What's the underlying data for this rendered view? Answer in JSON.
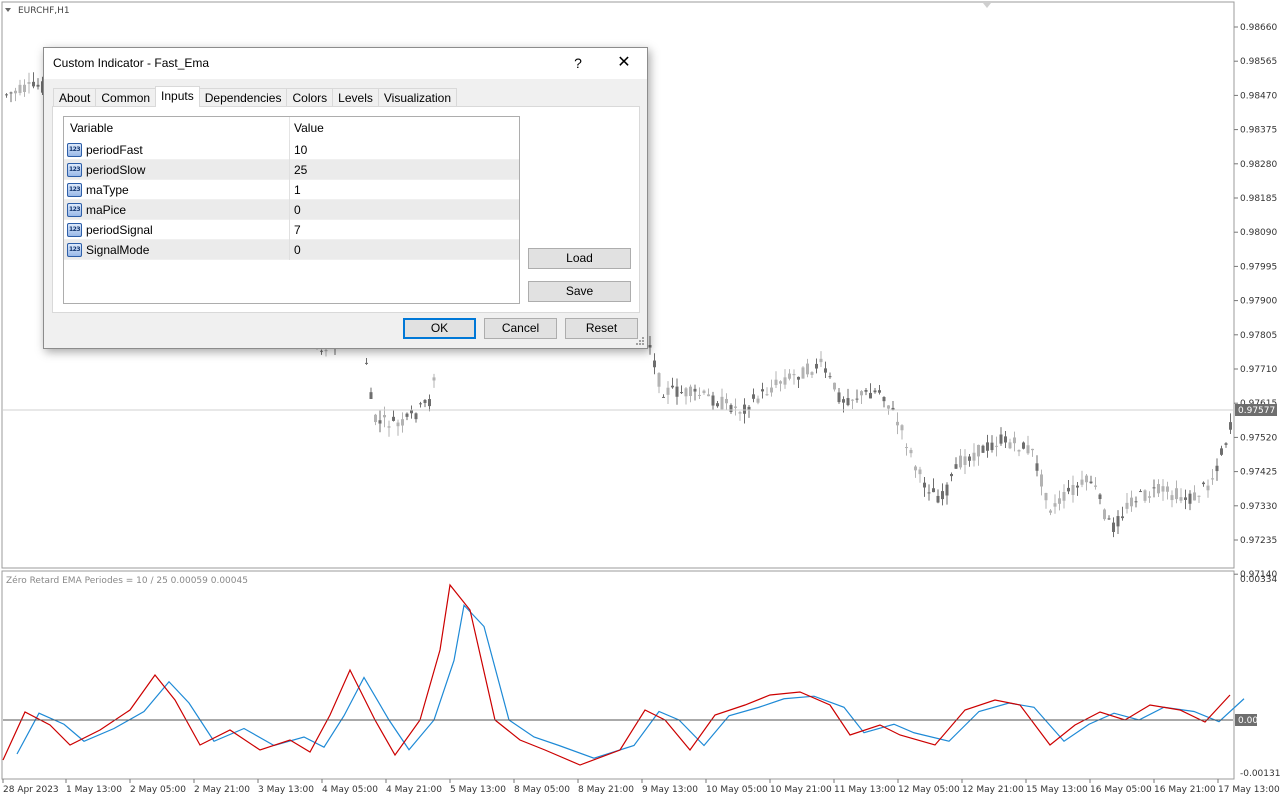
{
  "chart": {
    "symbol_label": "EURCHF,H1",
    "indicator_label": "Zéro Retard EMA Periodes = 10 / 25  0.00059 0.00045",
    "price_labels": [
      "0.98660",
      "0.98565",
      "0.98470",
      "0.98375",
      "0.98280",
      "0.98185",
      "0.98090",
      "0.97995",
      "0.97900",
      "0.97805",
      "0.97710",
      "0.97615",
      "0.97520",
      "0.97425",
      "0.97330",
      "0.97235",
      "0.97140"
    ],
    "current_price": "0.97577",
    "indicator_labels": [
      "0.00334",
      "0.00",
      "-0.00131"
    ],
    "time_labels": [
      "28 Apr 2023",
      "1 May 13:00",
      "2 May 05:00",
      "2 May 21:00",
      "3 May 13:00",
      "4 May 05:00",
      "4 May 21:00",
      "5 May 13:00",
      "8 May 05:00",
      "8 May 21:00",
      "9 May 13:00",
      "10 May 05:00",
      "10 May 21:00",
      "11 May 13:00",
      "12 May 05:00",
      "12 May 21:00",
      "15 May 13:00",
      "16 May 05:00",
      "16 May 21:00",
      "17 May 13:00"
    ],
    "colors": {
      "bull": "#b3b3b3",
      "bear": "#6e6e6e",
      "fast_line": "#cc0000",
      "slow_line": "#1e8ad6",
      "price_tag_bg": "#6e6e6e"
    }
  },
  "dialog": {
    "title": "Custom Indicator - Fast_Ema",
    "help_glyph": "?",
    "close_glyph": "✕",
    "tabs": [
      {
        "label": "About",
        "active": false
      },
      {
        "label": "Common",
        "active": false
      },
      {
        "label": "Inputs",
        "active": true
      },
      {
        "label": "Dependencies",
        "active": false
      },
      {
        "label": "Colors",
        "active": false
      },
      {
        "label": "Levels",
        "active": false
      },
      {
        "label": "Visualization",
        "active": false
      }
    ],
    "columns": {
      "variable": "Variable",
      "value": "Value"
    },
    "param_icon_text": "123",
    "params": [
      {
        "name": "periodFast",
        "value": "10"
      },
      {
        "name": "periodSlow",
        "value": "25"
      },
      {
        "name": "maType",
        "value": "1"
      },
      {
        "name": "maPice",
        "value": "0"
      },
      {
        "name": "periodSignal",
        "value": "7"
      },
      {
        "name": "SignalMode",
        "value": "0"
      }
    ],
    "buttons": {
      "load": "Load",
      "save": "Save",
      "ok": "OK",
      "cancel": "Cancel",
      "reset": "Reset"
    }
  }
}
